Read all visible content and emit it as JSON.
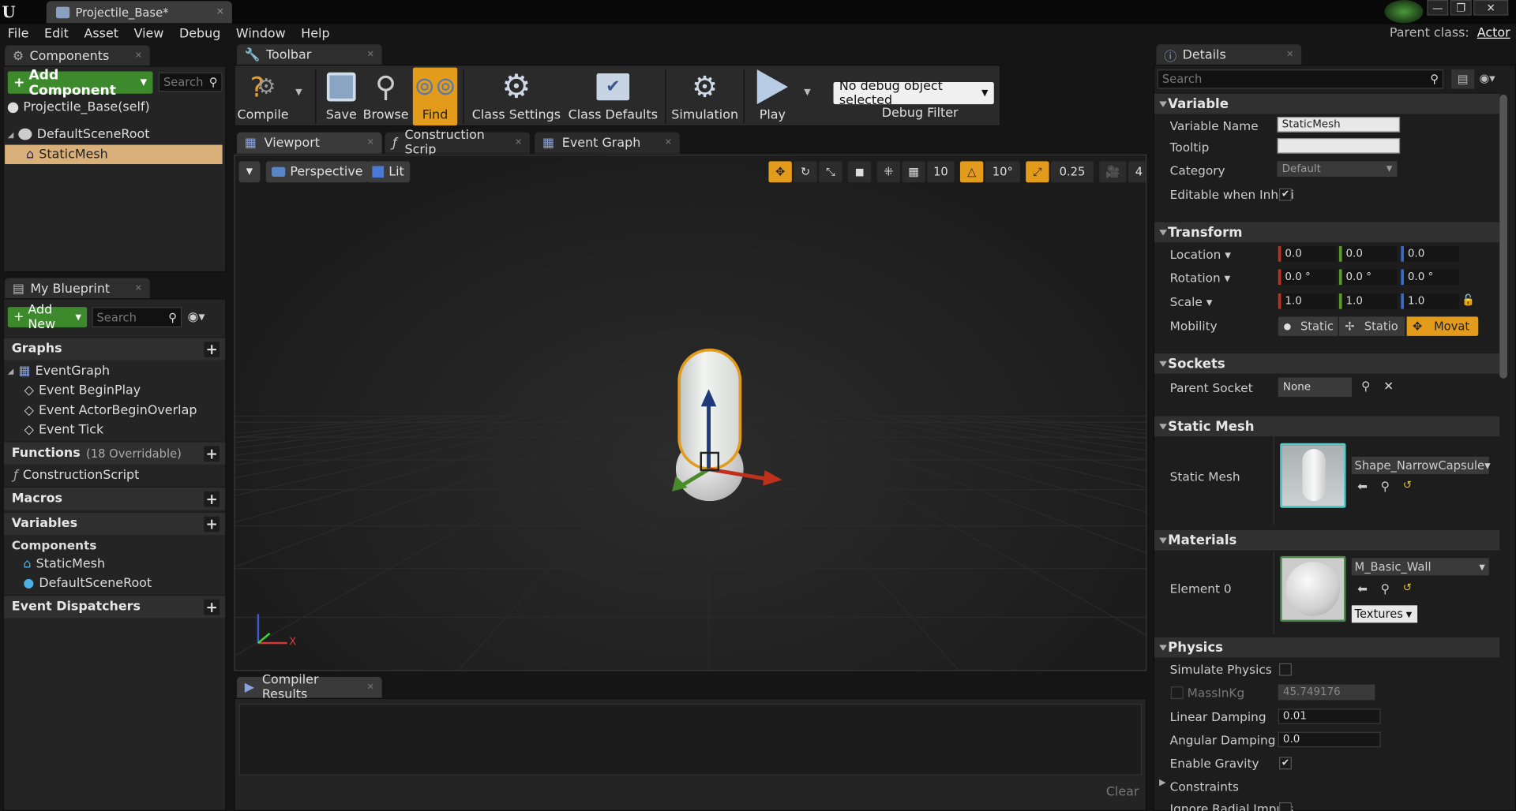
{
  "window": {
    "tab_title": "Projectile_Base*",
    "parent_class_label": "Parent class:",
    "parent_class_value": "Actor"
  },
  "menu": [
    "File",
    "Edit",
    "Asset",
    "View",
    "Debug",
    "Window",
    "Help"
  ],
  "components": {
    "tab": "Components",
    "add_button": "Add Component",
    "search_placeholder": "Search",
    "self_label": "Projectile_Base(self)",
    "tree": [
      "DefaultSceneRoot",
      "StaticMesh"
    ]
  },
  "my_blueprint": {
    "tab": "My Blueprint",
    "add_new": "Add New",
    "search_placeholder": "Search",
    "graphs_label": "Graphs",
    "event_graph": "EventGraph",
    "events": [
      "Event BeginPlay",
      "Event ActorBeginOverlap",
      "Event Tick"
    ],
    "functions_label": "Functions",
    "functions_count": "(18 Overridable)",
    "function_items": [
      "ConstructionScript"
    ],
    "macros_label": "Macros",
    "variables_label": "Variables",
    "components_label": "Components",
    "component_vars": [
      "StaticMesh",
      "DefaultSceneRoot"
    ],
    "dispatchers_label": "Event Dispatchers"
  },
  "toolbar": {
    "tab": "Toolbar",
    "compile": "Compile",
    "save": "Save",
    "browse": "Browse",
    "find": "Find",
    "class_settings": "Class Settings",
    "class_defaults": "Class Defaults",
    "simulation": "Simulation",
    "play": "Play",
    "debug_select": "No debug object selected",
    "debug_filter": "Debug Filter"
  },
  "editor_tabs": [
    "Viewport",
    "Construction Scrip",
    "Event Graph"
  ],
  "viewport": {
    "perspective": "Perspective",
    "lit": "Lit",
    "grid_snap": "10",
    "rot_snap": "10°",
    "scale_snap": "0.25",
    "cam_speed": "4",
    "axis_x": "X"
  },
  "compiler": {
    "tab": "Compiler Results",
    "clear": "Clear"
  },
  "details": {
    "tab": "Details",
    "search_placeholder": "Search",
    "sections": {
      "variable": "Variable",
      "transform": "Transform",
      "sockets": "Sockets",
      "static_mesh": "Static Mesh",
      "materials": "Materials",
      "physics": "Physics"
    },
    "variable_name_label": "Variable Name",
    "variable_name": "StaticMesh",
    "tooltip_label": "Tooltip",
    "tooltip_value": "",
    "category_label": "Category",
    "category_value": "Default",
    "editable_label": "Editable when Inheri",
    "location_label": "Location",
    "location": [
      "0.0",
      "0.0",
      "0.0"
    ],
    "rotation_label": "Rotation",
    "rotation": [
      "0.0 °",
      "0.0 °",
      "0.0 °"
    ],
    "scale_label": "Scale",
    "scale": [
      "1.0",
      "1.0",
      "1.0"
    ],
    "mobility_label": "Mobility",
    "mobility_options": [
      "Static",
      "Statio",
      "Movat"
    ],
    "parent_socket_label": "Parent Socket",
    "parent_socket_value": "None",
    "static_mesh_label": "Static Mesh",
    "static_mesh_value": "Shape_NarrowCapsule",
    "element0_label": "Element 0",
    "material_value": "M_Basic_Wall",
    "textures_label": "Textures",
    "simulate_physics_label": "Simulate Physics",
    "mass_label": "MassInKg",
    "mass_value": "45.749176",
    "linear_damping_label": "Linear Damping",
    "linear_damping": "0.01",
    "angular_damping_label": "Angular Damping",
    "angular_damping": "0.0",
    "enable_gravity_label": "Enable Gravity",
    "constraints_label": "Constraints",
    "ignore_radial_label": "Ignore Radial Impuls"
  },
  "colors": {
    "accent_orange": "#e39b1c",
    "green_button": "#3c8a2c",
    "selection": "#d9b07a"
  }
}
